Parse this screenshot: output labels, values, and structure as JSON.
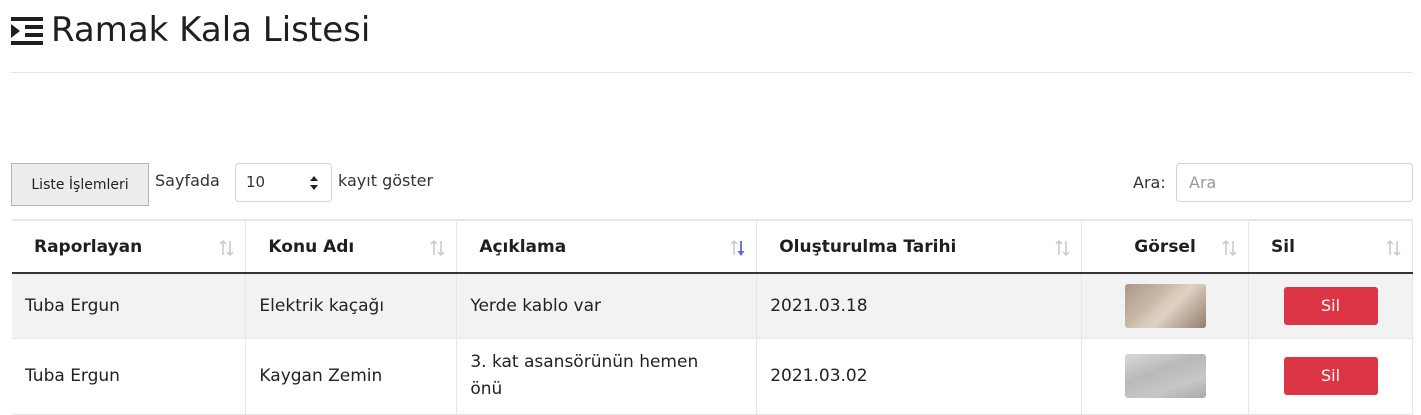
{
  "header": {
    "title": "Ramak Kala Listesi",
    "icon": "indent-list-icon"
  },
  "controls": {
    "list_ops_label": "Liste İşlemleri",
    "per_page_prefix": "Sayfada",
    "per_page_value": "10",
    "per_page_suffix": "kayıt göster",
    "search_label": "Ara:",
    "search_placeholder": "Ara"
  },
  "table": {
    "columns": [
      "Raporlayan",
      "Konu Adı",
      "Açıklama",
      "Oluşturulma Tarihi",
      "Görsel",
      "Sil"
    ],
    "sorted_column": "Açıklama",
    "rows": [
      {
        "raporlayan": "Tuba Ergun",
        "konu": "Elektrik kaçağı",
        "aciklama": "Yerde kablo var",
        "tarih": "2021.03.18",
        "sil": "Sil"
      },
      {
        "raporlayan": "Tuba Ergun",
        "konu": "Kaygan Zemin",
        "aciklama": "3. kat asansörünün hemen önü",
        "tarih": "2021.03.02",
        "sil": "Sil"
      }
    ]
  },
  "colors": {
    "danger": "#dc3545",
    "sort_active": "#5b6bd5",
    "row_stripe": "#f2f2f2"
  }
}
